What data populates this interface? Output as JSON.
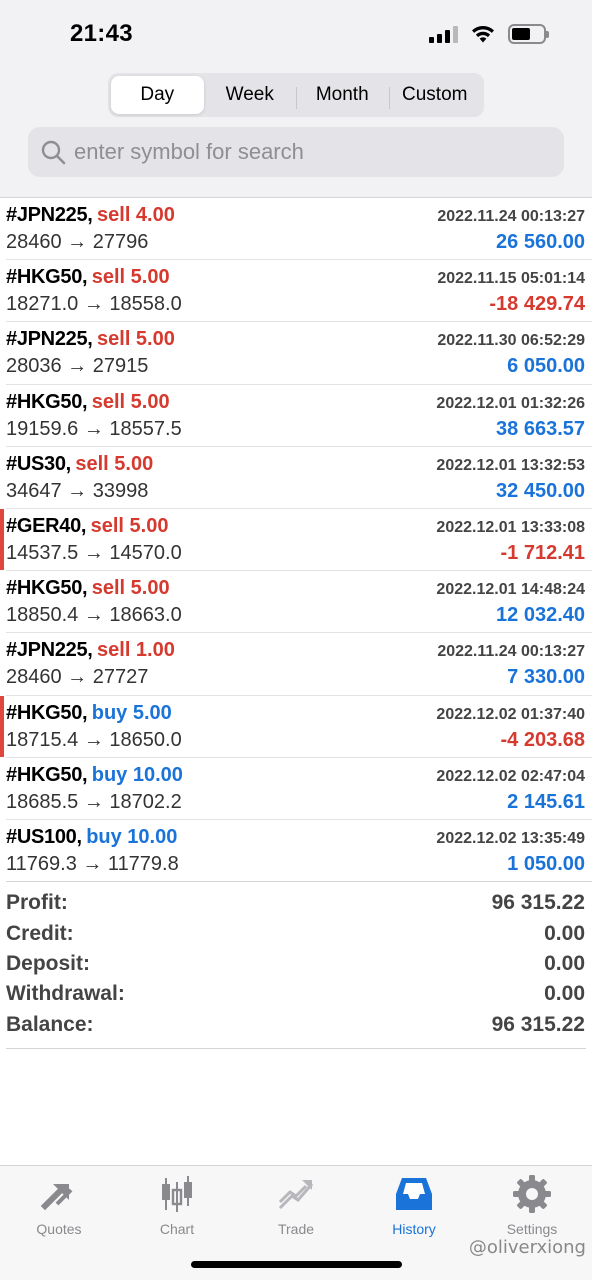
{
  "status_bar": {
    "time": "21:43"
  },
  "periods": {
    "tabs": [
      "Day",
      "Week",
      "Month",
      "Custom"
    ],
    "active": "Day"
  },
  "search": {
    "placeholder": "enter symbol for search"
  },
  "deals": [
    {
      "symbol": "#JPN225,",
      "side": "sell 4.00",
      "direction": "sell",
      "time": "2022.11.24 00:13:27",
      "prices": "28460 → 27796",
      "profit": "26 560.00",
      "profit_sign": "pos",
      "flag": false
    },
    {
      "symbol": "#HKG50,",
      "side": "sell 5.00",
      "direction": "sell",
      "time": "2022.11.15 05:01:14",
      "prices": "18271.0 → 18558.0",
      "profit": "-18 429.74",
      "profit_sign": "neg",
      "flag": false
    },
    {
      "symbol": "#JPN225,",
      "side": "sell 5.00",
      "direction": "sell",
      "time": "2022.11.30 06:52:29",
      "prices": "28036 → 27915",
      "profit": "6 050.00",
      "profit_sign": "pos",
      "flag": false
    },
    {
      "symbol": "#HKG50,",
      "side": "sell 5.00",
      "direction": "sell",
      "time": "2022.12.01 01:32:26",
      "prices": "19159.6 → 18557.5",
      "profit": "38 663.57",
      "profit_sign": "pos",
      "flag": false
    },
    {
      "symbol": "#US30,",
      "side": "sell 5.00",
      "direction": "sell",
      "time": "2022.12.01 13:32:53",
      "prices": "34647 → 33998",
      "profit": "32 450.00",
      "profit_sign": "pos",
      "flag": false
    },
    {
      "symbol": "#GER40,",
      "side": "sell 5.00",
      "direction": "sell",
      "time": "2022.12.01 13:33:08",
      "prices": "14537.5 → 14570.0",
      "profit": "-1 712.41",
      "profit_sign": "neg",
      "flag": true
    },
    {
      "symbol": "#HKG50,",
      "side": "sell 5.00",
      "direction": "sell",
      "time": "2022.12.01 14:48:24",
      "prices": "18850.4 → 18663.0",
      "profit": "12 032.40",
      "profit_sign": "pos",
      "flag": false
    },
    {
      "symbol": "#JPN225,",
      "side": "sell 1.00",
      "direction": "sell",
      "time": "2022.11.24 00:13:27",
      "prices": "28460 → 27727",
      "profit": "7 330.00",
      "profit_sign": "pos",
      "flag": false
    },
    {
      "symbol": "#HKG50,",
      "side": "buy 5.00",
      "direction": "buy",
      "time": "2022.12.02 01:37:40",
      "prices": "18715.4 → 18650.0",
      "profit": "-4 203.68",
      "profit_sign": "neg",
      "flag": true
    },
    {
      "symbol": "#HKG50,",
      "side": "buy 10.00",
      "direction": "buy",
      "time": "2022.12.02 02:47:04",
      "prices": "18685.5 → 18702.2",
      "profit": "2 145.61",
      "profit_sign": "pos",
      "flag": false
    },
    {
      "symbol": "#US100,",
      "side": "buy 10.00",
      "direction": "buy",
      "time": "2022.12.02 13:35:49",
      "prices": "11769.3 → 11779.8",
      "profit": "1 050.00",
      "profit_sign": "pos",
      "flag": false
    }
  ],
  "summary": [
    {
      "label": "Profit:",
      "value": "96 315.22"
    },
    {
      "label": "Credit:",
      "value": "0.00"
    },
    {
      "label": "Deposit:",
      "value": "0.00"
    },
    {
      "label": "Withdrawal:",
      "value": "0.00"
    },
    {
      "label": "Balance:",
      "value": "96 315.22"
    }
  ],
  "tabbar": [
    {
      "label": "Quotes",
      "icon": "quotes-arrows-icon",
      "active": false
    },
    {
      "label": "Chart",
      "icon": "candlestick-chart-icon",
      "active": false
    },
    {
      "label": "Trade",
      "icon": "trade-trend-icon",
      "active": false
    },
    {
      "label": "History",
      "icon": "history-inbox-icon",
      "active": true
    },
    {
      "label": "Settings",
      "icon": "gear-icon",
      "active": false
    }
  ],
  "watermark": "@oliverxiong",
  "colors": {
    "sell": "#d63a2f",
    "buy": "#1a73d9",
    "negative": "#d63a2f",
    "positive": "#1a73d9",
    "active_tab": "#1a73d9",
    "inactive_tab": "#8a8a8e"
  }
}
